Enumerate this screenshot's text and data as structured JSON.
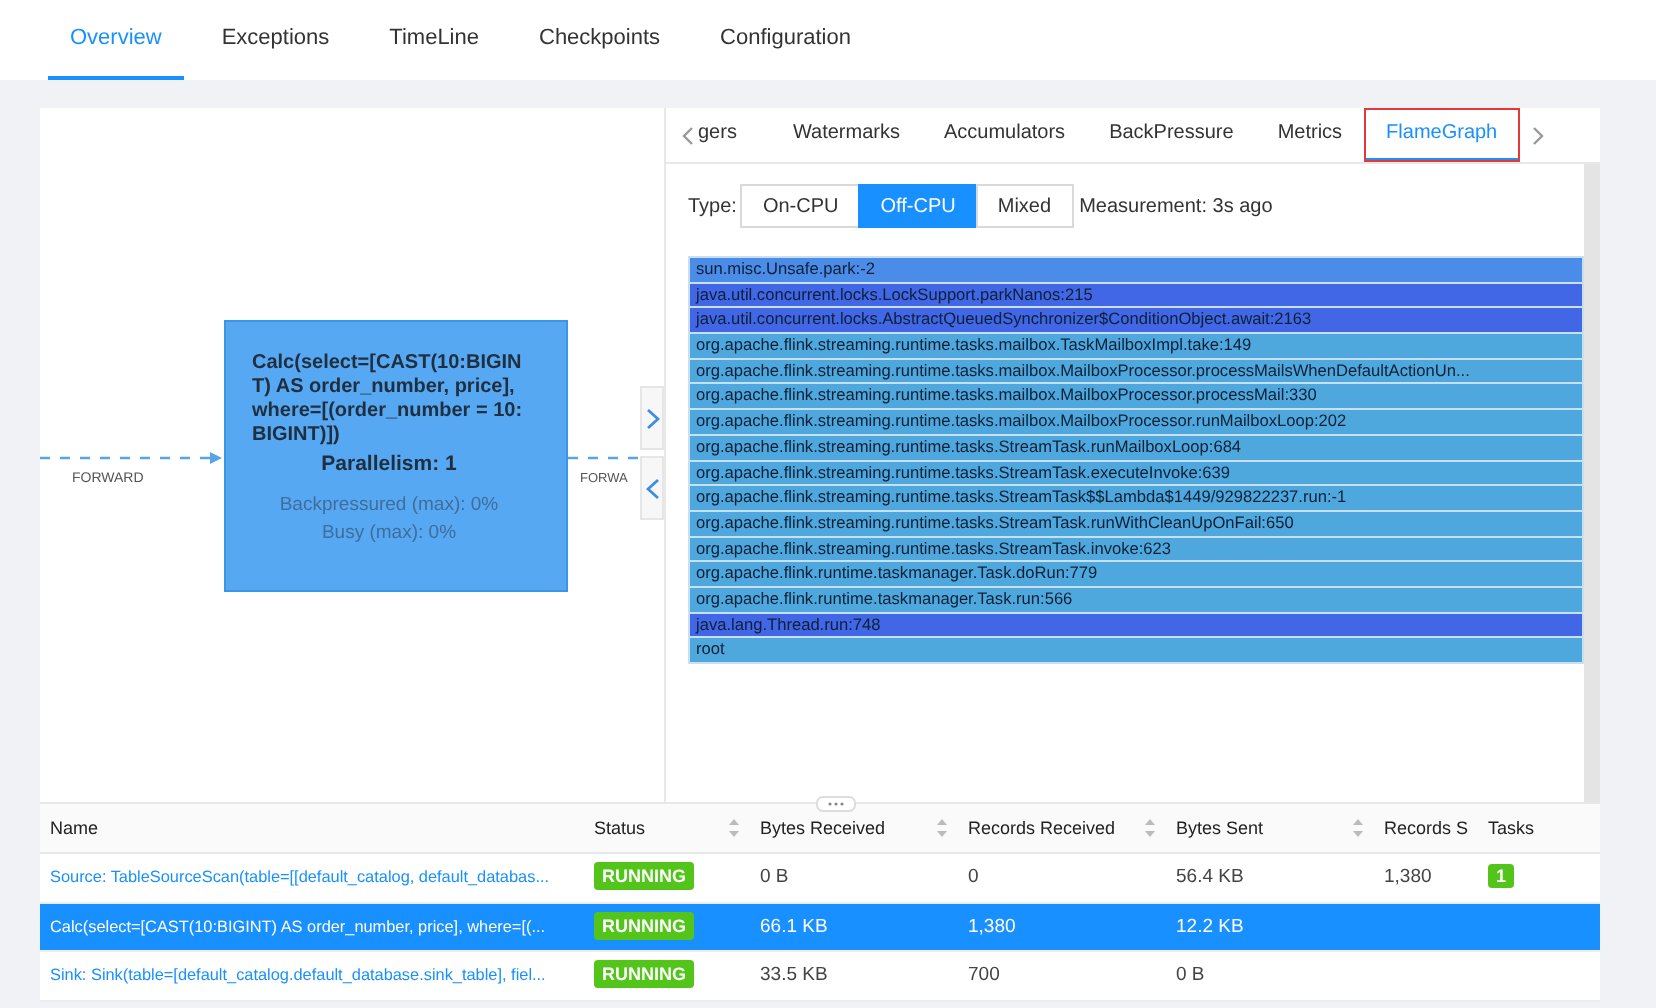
{
  "top_tabs": [
    {
      "label": "Overview",
      "selected": true
    },
    {
      "label": "Exceptions",
      "selected": false
    },
    {
      "label": "TimeLine",
      "selected": false
    },
    {
      "label": "Checkpoints",
      "selected": false
    },
    {
      "label": "Configuration",
      "selected": false
    }
  ],
  "graph": {
    "node": {
      "title": "Calc(select=[CAST(10:BIGINT) AS order_number, price], where=[(order_number = 10:BIGINT)])",
      "parallelism": "Parallelism: 1",
      "backpressured": "Backpressured (max): 0%",
      "busy": "Busy (max): 0%"
    },
    "edges": [
      {
        "label": "FORWARD"
      },
      {
        "label": "FORWA"
      }
    ]
  },
  "detail_tabs": [
    {
      "label": "gers",
      "selected": false,
      "highlighted": false
    },
    {
      "label": "Watermarks",
      "selected": false,
      "highlighted": false
    },
    {
      "label": "Accumulators",
      "selected": false,
      "highlighted": false
    },
    {
      "label": "BackPressure",
      "selected": false,
      "highlighted": false
    },
    {
      "label": "Metrics",
      "selected": false,
      "highlighted": false
    },
    {
      "label": "FlameGraph",
      "selected": true,
      "highlighted": true
    }
  ],
  "flamegraph": {
    "type_label": "Type:",
    "types": [
      {
        "label": "On-CPU",
        "selected": false
      },
      {
        "label": "Off-CPU",
        "selected": true
      },
      {
        "label": "Mixed",
        "selected": false
      }
    ],
    "measurement": "Measurement: 3s ago",
    "frames": [
      {
        "label": "sun.misc.Unsafe.park:-2",
        "color": "#4a8ce8"
      },
      {
        "label": "java.util.concurrent.locks.LockSupport.parkNanos:215",
        "color": "#4166e6"
      },
      {
        "label": "java.util.concurrent.locks.AbstractQueuedSynchronizer$ConditionObject.await:2163",
        "color": "#4166e6"
      },
      {
        "label": "org.apache.flink.streaming.runtime.tasks.mailbox.TaskMailboxImpl.take:149",
        "color": "#4ea8de"
      },
      {
        "label": "org.apache.flink.streaming.runtime.tasks.mailbox.MailboxProcessor.processMailsWhenDefaultActionUn...",
        "color": "#4ea8de"
      },
      {
        "label": "org.apache.flink.streaming.runtime.tasks.mailbox.MailboxProcessor.processMail:330",
        "color": "#4ea8de"
      },
      {
        "label": "org.apache.flink.streaming.runtime.tasks.mailbox.MailboxProcessor.runMailboxLoop:202",
        "color": "#4ea8de"
      },
      {
        "label": "org.apache.flink.streaming.runtime.tasks.StreamTask.runMailboxLoop:684",
        "color": "#4ea8de"
      },
      {
        "label": "org.apache.flink.streaming.runtime.tasks.StreamTask.executeInvoke:639",
        "color": "#4ea8de"
      },
      {
        "label": "org.apache.flink.streaming.runtime.tasks.StreamTask$$Lambda$1449/929822237.run:-1",
        "color": "#4ea8de"
      },
      {
        "label": "org.apache.flink.streaming.runtime.tasks.StreamTask.runWithCleanUpOnFail:650",
        "color": "#4ea8de"
      },
      {
        "label": "org.apache.flink.streaming.runtime.tasks.StreamTask.invoke:623",
        "color": "#4ea8de"
      },
      {
        "label": "org.apache.flink.runtime.taskmanager.Task.doRun:779",
        "color": "#4ea8de"
      },
      {
        "label": "org.apache.flink.runtime.taskmanager.Task.run:566",
        "color": "#4ea8de"
      },
      {
        "label": "java.lang.Thread.run:748",
        "color": "#4166e6"
      },
      {
        "label": "root",
        "color": "#4ea8de"
      }
    ]
  },
  "table": {
    "columns": [
      "Name",
      "Status",
      "Bytes Received",
      "Records Received",
      "Bytes Sent",
      "Records S",
      "Tasks"
    ],
    "rows": [
      {
        "selected": false,
        "name": "Source: TableSourceScan(table=[[default_catalog, default_databas...",
        "status": "RUNNING",
        "bytes_received": "0 B",
        "records_received": "0",
        "bytes_sent": "56.4 KB",
        "records_sent": "1,380",
        "tasks": "1"
      },
      {
        "selected": true,
        "name": "Calc(select=[CAST(10:BIGINT) AS order_number, price], where=[(...",
        "status": "RUNNING",
        "bytes_received": "66.1 KB",
        "records_received": "1,380",
        "bytes_sent": "12.2 KB"
      },
      {
        "selected": false,
        "name": "Sink: Sink(table=[default_catalog.default_database.sink_table], fiel...",
        "status": "RUNNING",
        "bytes_received": "33.5 KB",
        "records_received": "700",
        "bytes_sent": "0 B"
      }
    ]
  }
}
